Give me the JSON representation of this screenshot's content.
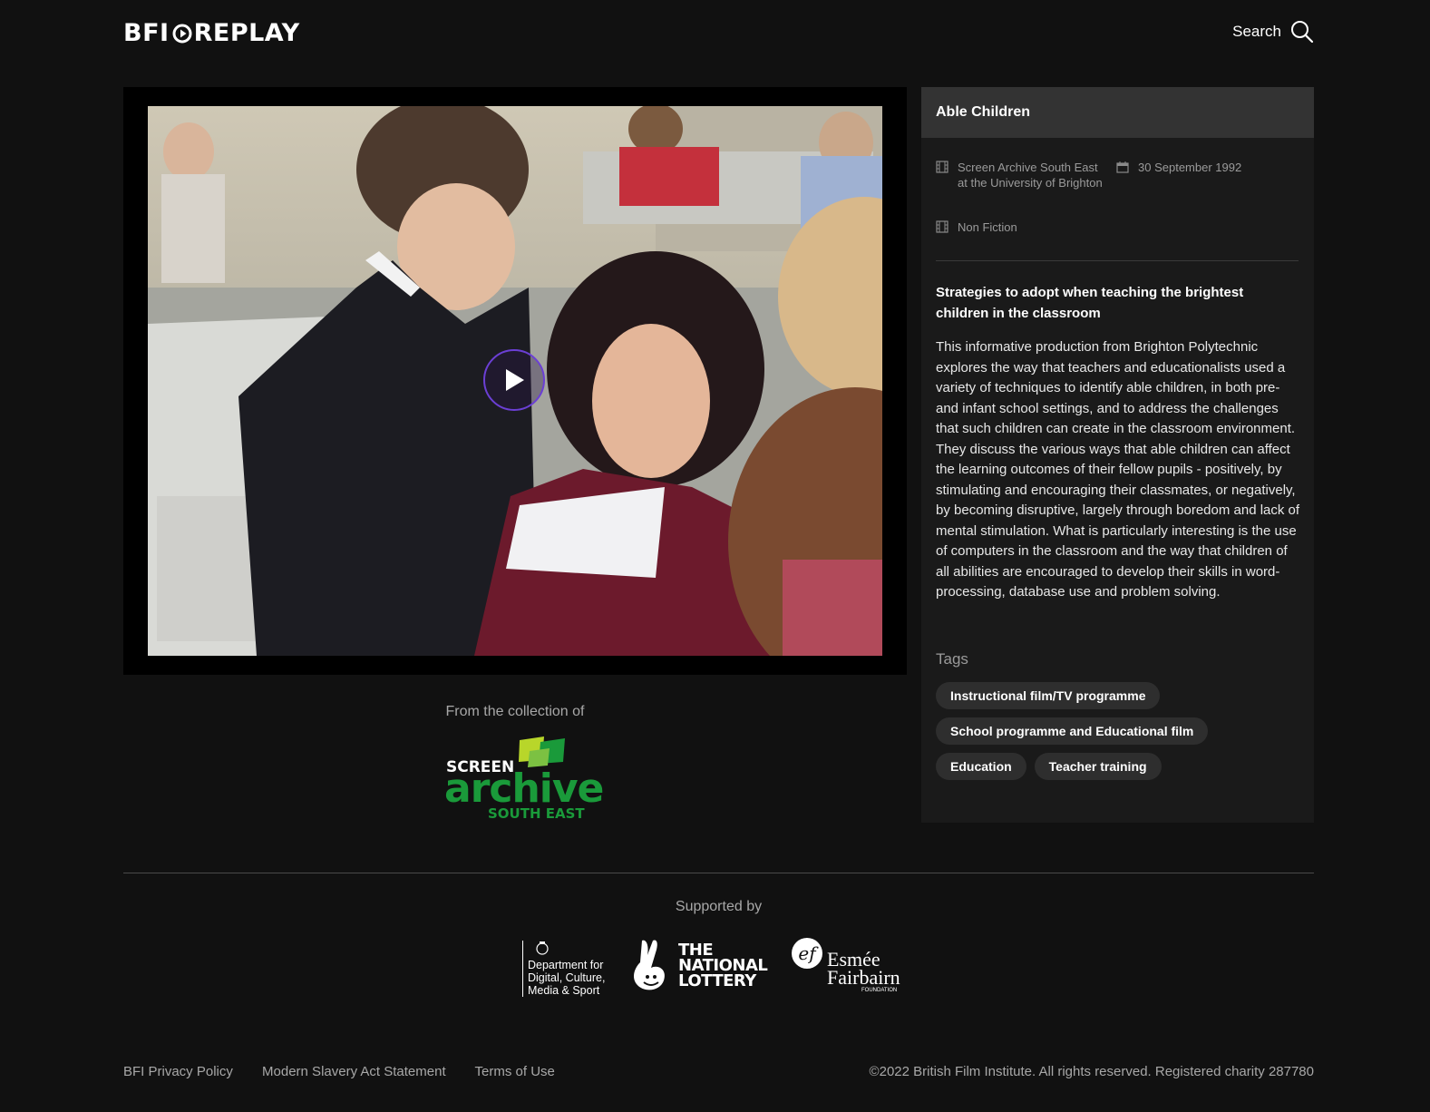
{
  "header": {
    "logo_left": "BFI",
    "logo_right": "REPLAY",
    "search_label": "Search"
  },
  "film": {
    "title": "Able Children",
    "collection_source": "Screen Archive South East at the University of Brighton",
    "date": "30 September 1992",
    "genre": "Non Fiction",
    "subtitle": "Strategies to adopt when teaching the brightest children in the classroom",
    "description": "This informative production from Brighton Polytechnic explores the way that teachers and educationalists used a variety of techniques to identify able children, in both pre- and infant school settings, and to address the challenges that such children can create in the classroom environment. They discuss the various ways that able children can affect the learning outcomes of their fellow pupils - positively, by stimulating and encouraging their classmates, or negatively, by becoming disruptive, largely through boredom and lack of mental stimulation. What is particularly interesting is the use of computers in the classroom and the way that children of all abilities are encouraged to develop their skills in word-processing, database use and problem solving.",
    "tags_label": "Tags",
    "tags": [
      "Instructional film/TV programme",
      "School programme and Educational film",
      "Education",
      "Teacher training"
    ]
  },
  "collection": {
    "label": "From the collection of",
    "logo_line1": "SCREEN",
    "logo_line2": "archive",
    "logo_line3": "SOUTH EAST"
  },
  "supporters": {
    "label": "Supported by",
    "dcms": "Department for Digital, Culture, Media & Sport",
    "lottery_line1": "THE",
    "lottery_line2": "NATIONAL",
    "lottery_line3": "LOTTERY",
    "esmee_line1": "Esmée",
    "esmee_line2": "Fairbairn",
    "esmee_line3": "FOUNDATION"
  },
  "footer": {
    "links": [
      "BFI Privacy Policy",
      "Modern Slavery Act Statement",
      "Terms of Use"
    ],
    "copyright": "©2022 British Film Institute. All rights reserved. Registered charity 287780"
  },
  "colors": {
    "background": "#111111",
    "panel": "#1a1a1a",
    "panel_header": "#333333",
    "play_ring": "#6b3fd4",
    "sase_green": "#1a9a3a",
    "sase_lime": "#b8d62a"
  }
}
